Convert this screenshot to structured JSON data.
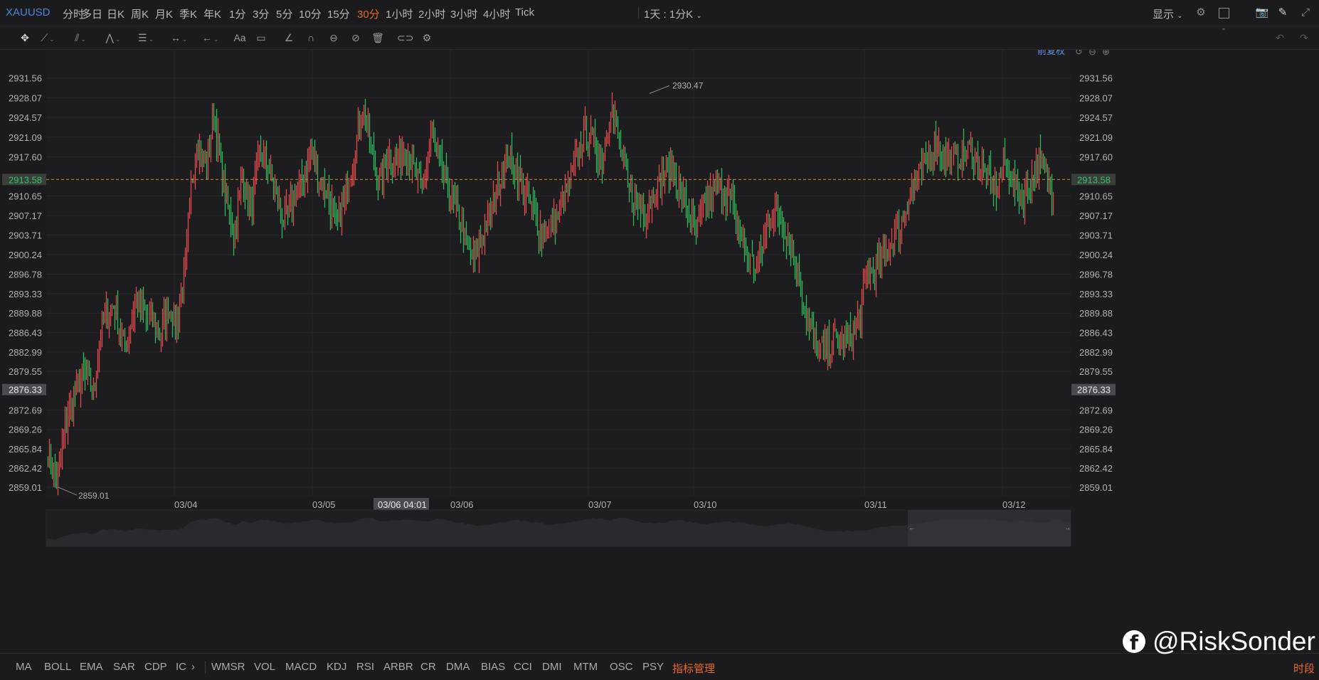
{
  "app": {
    "symbol": "XAUUSD",
    "timeframes": [
      "分时",
      "多日",
      "日K",
      "周K",
      "月K",
      "季K",
      "年K",
      "1分",
      "3分",
      "5分",
      "10分",
      "15分",
      "30分",
      "1小时",
      "2小时",
      "3小时",
      "4小时",
      "Tick"
    ],
    "active_timeframe": "30分",
    "range_selector": "1天 : 1分K",
    "display_label": "显示",
    "adjust_label": "前复权",
    "icons": [
      "gear-icon",
      "square-icon",
      "camera-icon",
      "pencil-icon",
      "fullscreen-icon"
    ]
  },
  "toolbar": {
    "tools": [
      "move-icon",
      "line-icon",
      "channel-icon",
      "pattern-icon",
      "fib-icon",
      "measure-icon",
      "arrow-icon",
      "text-icon",
      "comment-icon",
      "brush-icon",
      "magnet-icon",
      "lock-icon",
      "hide-icon",
      "trash-icon",
      "link-icon",
      "settings-icon"
    ],
    "font_label": "Aa"
  },
  "chart_data": {
    "type": "ohlc",
    "symbol": "XAUUSD",
    "y_ticks": [
      "2931.56",
      "2928.07",
      "2924.57",
      "2921.09",
      "2917.60",
      "2910.65",
      "2907.17",
      "2903.71",
      "2900.24",
      "2896.78",
      "2893.33",
      "2889.88",
      "2886.43",
      "2882.99",
      "2879.55",
      "2872.69",
      "2869.26",
      "2865.84",
      "2862.42",
      "2859.01"
    ],
    "ylim": [
      2857.5,
      2934.3
    ],
    "current_price": "2913.58",
    "crosshair_price": "2876.33",
    "crosshair_time": "03/06 04:01",
    "x_labels": [
      "03/04",
      "03/05",
      "03/06",
      "03/07",
      "03/10",
      "03/11",
      "03/12"
    ],
    "high_annotation": "2930.47",
    "low_annotation": "2859.01",
    "colors": {
      "up": "#e0494c",
      "down": "#2fb65a",
      "price_line": "#d9843a"
    },
    "anchors": [
      [
        0,
        2865
      ],
      [
        6,
        2860
      ],
      [
        14,
        2872
      ],
      [
        24,
        2879
      ],
      [
        32,
        2876
      ],
      [
        38,
        2888
      ],
      [
        46,
        2891
      ],
      [
        54,
        2884
      ],
      [
        62,
        2892
      ],
      [
        70,
        2889
      ],
      [
        78,
        2886
      ],
      [
        84,
        2891
      ],
      [
        90,
        2888
      ],
      [
        96,
        2898
      ],
      [
        100,
        2912
      ],
      [
        104,
        2920
      ],
      [
        110,
        2916
      ],
      [
        116,
        2925
      ],
      [
        120,
        2918
      ],
      [
        124,
        2911
      ],
      [
        130,
        2904
      ],
      [
        136,
        2914
      ],
      [
        142,
        2908
      ],
      [
        148,
        2918
      ],
      [
        154,
        2916
      ],
      [
        160,
        2910
      ],
      [
        166,
        2906
      ],
      [
        172,
        2910
      ],
      [
        178,
        2913
      ],
      [
        184,
        2918
      ],
      [
        190,
        2914
      ],
      [
        196,
        2911
      ],
      [
        202,
        2906
      ],
      [
        208,
        2910
      ],
      [
        214,
        2918
      ],
      [
        220,
        2926
      ],
      [
        226,
        2919
      ],
      [
        232,
        2913
      ],
      [
        238,
        2918
      ],
      [
        244,
        2916
      ],
      [
        250,
        2920
      ],
      [
        256,
        2915
      ],
      [
        262,
        2912
      ],
      [
        268,
        2921
      ],
      [
        274,
        2917
      ],
      [
        280,
        2912
      ],
      [
        286,
        2908
      ],
      [
        292,
        2903
      ],
      [
        298,
        2899
      ],
      [
        304,
        2903
      ],
      [
        310,
        2908
      ],
      [
        316,
        2913
      ],
      [
        322,
        2918
      ],
      [
        328,
        2915
      ],
      [
        334,
        2911
      ],
      [
        340,
        2908
      ],
      [
        346,
        2904
      ],
      [
        352,
        2905
      ],
      [
        358,
        2908
      ],
      [
        364,
        2912
      ],
      [
        370,
        2917
      ],
      [
        376,
        2922
      ],
      [
        382,
        2920
      ],
      [
        388,
        2917
      ],
      [
        394,
        2927
      ],
      [
        400,
        2920
      ],
      [
        406,
        2912
      ],
      [
        412,
        2909
      ],
      [
        418,
        2908
      ],
      [
        424,
        2911
      ],
      [
        430,
        2914
      ],
      [
        436,
        2916
      ],
      [
        442,
        2912
      ],
      [
        448,
        2908
      ],
      [
        454,
        2904
      ],
      [
        460,
        2909
      ],
      [
        466,
        2911
      ],
      [
        472,
        2912
      ],
      [
        478,
        2910
      ],
      [
        484,
        2905
      ],
      [
        490,
        2900
      ],
      [
        496,
        2898
      ],
      [
        502,
        2904
      ],
      [
        508,
        2908
      ],
      [
        514,
        2906
      ],
      [
        520,
        2902
      ],
      [
        526,
        2896
      ],
      [
        532,
        2888
      ],
      [
        538,
        2884
      ],
      [
        544,
        2883
      ],
      [
        550,
        2885
      ],
      [
        556,
        2884
      ],
      [
        562,
        2886
      ],
      [
        568,
        2889
      ],
      [
        574,
        2897
      ],
      [
        580,
        2898
      ],
      [
        586,
        2900
      ],
      [
        592,
        2903
      ],
      [
        598,
        2906
      ],
      [
        604,
        2911
      ],
      [
        610,
        2914
      ],
      [
        616,
        2917
      ],
      [
        622,
        2920
      ],
      [
        628,
        2918
      ],
      [
        634,
        2917
      ],
      [
        640,
        2918
      ],
      [
        646,
        2919
      ],
      [
        652,
        2916
      ],
      [
        658,
        2914
      ],
      [
        664,
        2912
      ],
      [
        670,
        2917
      ],
      [
        676,
        2913
      ],
      [
        682,
        2910
      ],
      [
        688,
        2913
      ],
      [
        694,
        2917
      ],
      [
        700,
        2913
      ],
      [
        704,
        2912
      ]
    ]
  },
  "bottom": {
    "indicators": [
      "MA",
      "BOLL",
      "EMA",
      "SAR",
      "CDP",
      "IC",
      "WMSR",
      "VOL",
      "MACD",
      "KDJ",
      "RSI",
      "ARBR",
      "CR",
      "DMA",
      "BIAS",
      "CCI",
      "DMI",
      "MTM",
      "OSC",
      "PSY"
    ],
    "more_arrow": "›",
    "manage_label": "指标管理",
    "period_label": "时段"
  },
  "watermark": {
    "text": "@RiskSonder",
    "logo": "f"
  }
}
